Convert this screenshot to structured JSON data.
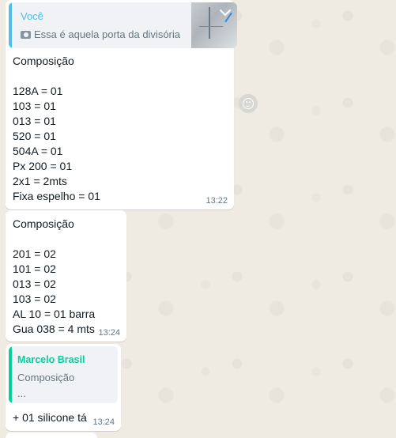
{
  "messages": [
    {
      "quote": {
        "author": "Você",
        "text": "Essa é aquela porta da divisória",
        "media_icon": "camera-icon"
      },
      "text": "Composição\n\n128A = 01\n103 = 01\n013 = 01\n520 = 01\n504A = 01\nPx 200 = 01\n2x1 = 2mts\nFixa espelho = 01",
      "time": "13:22"
    },
    {
      "text": "Composição\n\n201 = 02\n101 = 02\n013 = 02\n103 = 02\nAL 10 = 01 barra\nGua 038 = 4 mts",
      "time": "13:24"
    },
    {
      "quote": {
        "author": "Marcelo Brasil",
        "line1": "Composição",
        "line2": "..."
      },
      "text": "+ 01 silicone tá",
      "time": "13:24"
    }
  ],
  "colors": {
    "background": "#efeae2",
    "bubble": "#ffffff",
    "quote_you": "#53bdeb",
    "quote_other": "#06cf9c",
    "timestamp": "#667781"
  },
  "icons": {
    "emoji_button": "smiley-icon",
    "menu": "chevron-down-icon"
  }
}
